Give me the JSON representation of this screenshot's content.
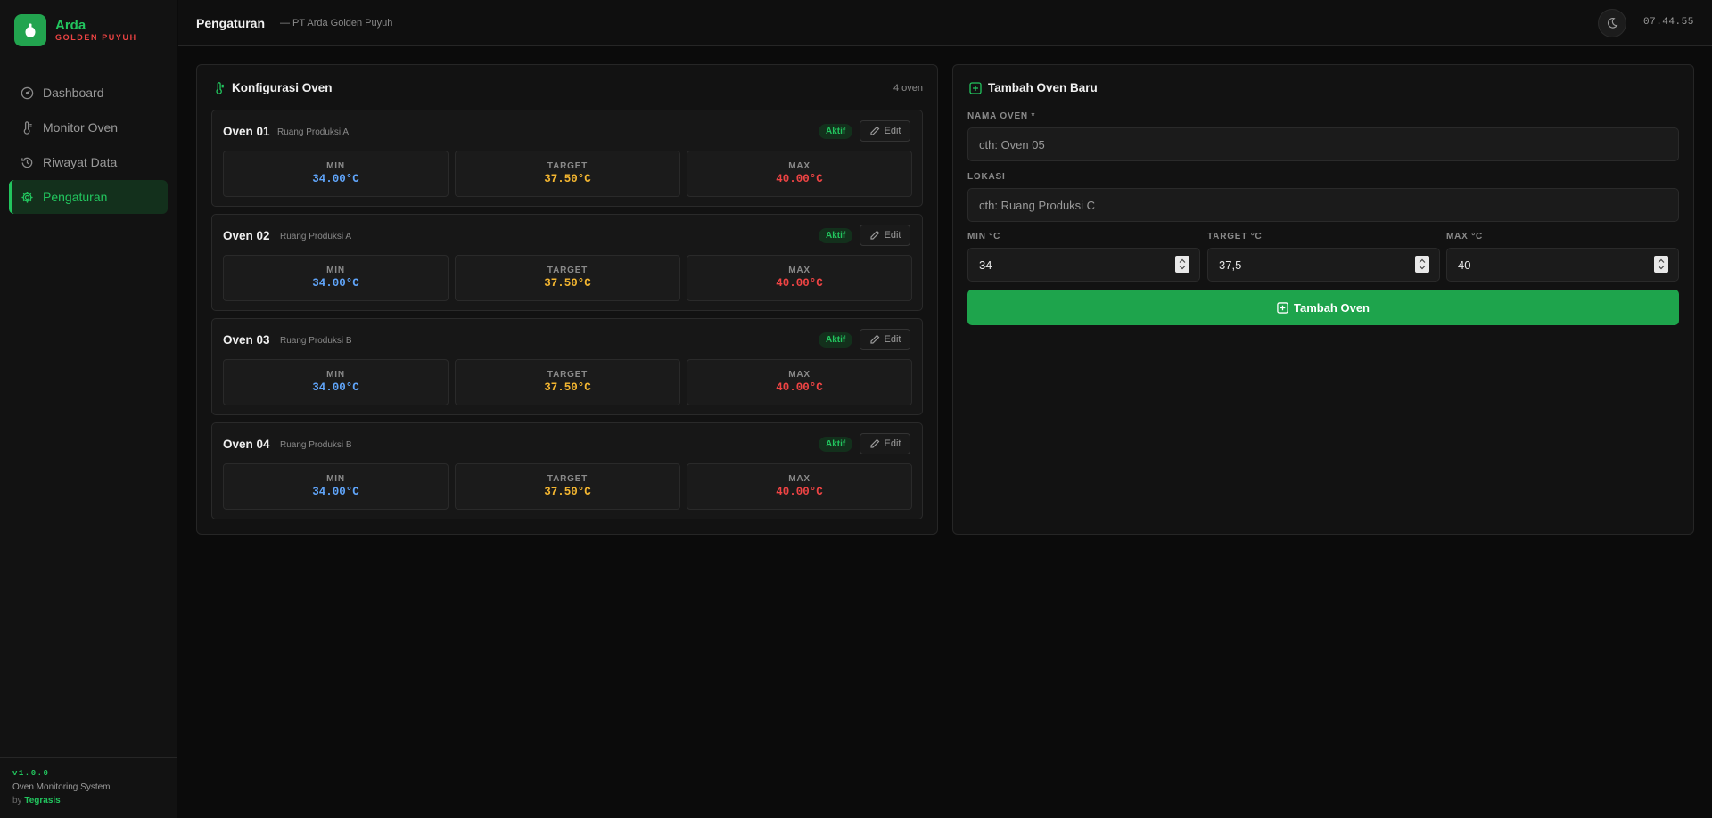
{
  "brand": {
    "name": "Arda",
    "subtitle": "GOLDEN PUYUH"
  },
  "sidebar": {
    "items": [
      {
        "label": "Dashboard",
        "icon": "gauge-icon",
        "active": false
      },
      {
        "label": "Monitor Oven",
        "icon": "thermometer-icon",
        "active": false
      },
      {
        "label": "Riwayat Data",
        "icon": "history-icon",
        "active": false
      },
      {
        "label": "Pengaturan",
        "icon": "gear-icon",
        "active": true
      }
    ],
    "footer": {
      "version": "v1.0.0",
      "system": "Oven Monitoring System",
      "by": "by",
      "author": "Tegrasis"
    }
  },
  "header": {
    "title": "Pengaturan",
    "subtitle": "— PT Arda Golden Puyuh",
    "clock": "07.44.55",
    "theme_icon": "moon-icon"
  },
  "config": {
    "title": "Konfigurasi Oven",
    "count": "4 oven",
    "labels": {
      "min": "MIN",
      "target": "TARGET",
      "max": "MAX"
    },
    "status": "Aktif",
    "edit_label": "Edit",
    "ovens": [
      {
        "name": "Oven 01",
        "location": "Ruang Produksi A",
        "min": "34.00°C",
        "target": "37.50°C",
        "max": "40.00°C"
      },
      {
        "name": "Oven 02",
        "location": "Ruang Produksi A",
        "min": "34.00°C",
        "target": "37.50°C",
        "max": "40.00°C"
      },
      {
        "name": "Oven 03",
        "location": "Ruang Produksi B",
        "min": "34.00°C",
        "target": "37.50°C",
        "max": "40.00°C"
      },
      {
        "name": "Oven 04",
        "location": "Ruang Produksi B",
        "min": "34.00°C",
        "target": "37.50°C",
        "max": "40.00°C"
      }
    ]
  },
  "form": {
    "title": "Tambah Oven Baru",
    "name_label": "NAMA OVEN *",
    "name_placeholder": "cth: Oven 05",
    "location_label": "LOKASI",
    "location_placeholder": "cth: Ruang Produksi C",
    "min_label": "MIN °C",
    "min_value": "34",
    "target_label": "TARGET °C",
    "target_value": "37,5",
    "max_label": "MAX °C",
    "max_value": "40",
    "submit_label": "Tambah Oven"
  },
  "colors": {
    "accent": "#22c55e",
    "button": "#1ea44c",
    "min": "#60a5fa",
    "target": "#f5b731",
    "max": "#ef4444"
  }
}
